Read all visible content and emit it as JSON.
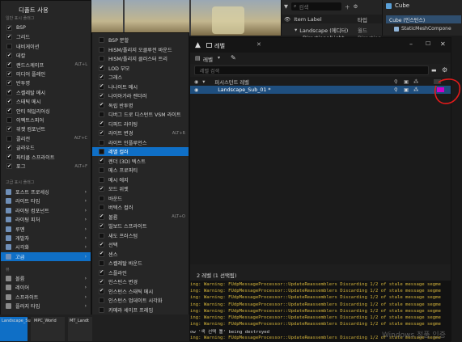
{
  "viewport": {},
  "outliner": {
    "search_placeholder": "검색",
    "col_item_label": "Item Label",
    "col_type": "타입",
    "row1_name": "Landscape (에디터)",
    "row1_type": "월드",
    "row2_name": "DirectionalLight",
    "row2_type": "Directiona"
  },
  "details": {
    "title": "Cube",
    "component_root": "Cube (인스턴스)",
    "component_child": "StaticMeshCompone"
  },
  "main_menu": {
    "title": "디폴트 사용",
    "section_general": "일반 표시 플래그",
    "items": [
      {
        "label": "BSP",
        "checked": true
      },
      {
        "label": "그리드",
        "checked": true
      },
      {
        "label": "내비게이션",
        "checked": false
      },
      {
        "label": "데칼",
        "checked": true
      },
      {
        "label": "랜드스케이프",
        "checked": true,
        "shortcut": "ALT+L"
      },
      {
        "label": "미디어 플레인",
        "checked": true
      },
      {
        "label": "반투명",
        "checked": true
      },
      {
        "label": "스켈레탈 메시",
        "checked": true
      },
      {
        "label": "스태틱 메시",
        "checked": true
      },
      {
        "label": "안티 에일리어싱",
        "checked": true
      },
      {
        "label": "이펙트스피어",
        "checked": false
      },
      {
        "label": "위젯 컴포넌트",
        "checked": true
      },
      {
        "label": "콜리전",
        "checked": false,
        "shortcut": "ALT+C"
      },
      {
        "label": "글라우드",
        "checked": true
      },
      {
        "label": "파티클 스프라이트",
        "checked": true
      },
      {
        "label": "포그",
        "checked": true,
        "shortcut": "ALT+F"
      }
    ],
    "section_advanced": "고급 표시 플래그",
    "submenus": [
      {
        "label": "포스트 프로세싱"
      },
      {
        "label": "라이트 타입"
      },
      {
        "label": "라이팅 컴포넌트"
      },
      {
        "label": "라이팅 피처"
      },
      {
        "label": "루멘"
      },
      {
        "label": "개발자"
      },
      {
        "label": "시각화"
      },
      {
        "label": "고급"
      }
    ],
    "section_views": "뷰",
    "view_submenus": [
      {
        "label": "볼륨"
      },
      {
        "label": "레이어"
      },
      {
        "label": "스프라이트"
      },
      {
        "label": "플러지 타입"
      }
    ]
  },
  "sub_menu": {
    "items": [
      {
        "label": "BSP 분할",
        "checked": false
      },
      {
        "label": "HISM/폴리지 오클루전 바운드",
        "checked": false
      },
      {
        "label": "HISM/폴리지 클러스터 트리",
        "checked": false
      },
      {
        "label": "LOD 부모",
        "checked": true
      },
      {
        "label": "그래스",
        "checked": true
      },
      {
        "label": "나나이트 메시",
        "checked": true
      },
      {
        "label": "나이아가라 렌더러",
        "checked": true
      },
      {
        "label": "독립 반투명",
        "checked": true
      },
      {
        "label": "디버그 드로 디스턴트 VSM 라이트",
        "checked": false
      },
      {
        "label": "디퍼드 라이팅",
        "checked": true
      },
      {
        "label": "라이트 변경",
        "checked": true,
        "shortcut": "ALT+R"
      },
      {
        "label": "라이트 인플루언스",
        "checked": false
      },
      {
        "label": "레벨 컬러",
        "checked": false,
        "selected": true
      },
      {
        "label": "렌더 (3D) 텍스트",
        "checked": true
      },
      {
        "label": "메스 프로퍼티",
        "checked": false
      },
      {
        "label": "메시 에지",
        "checked": false
      },
      {
        "label": "모드 위젯",
        "checked": true
      },
      {
        "label": "바운드",
        "checked": false
      },
      {
        "label": "버텍스 컬러",
        "checked": false
      },
      {
        "label": "볼륨",
        "checked": true,
        "shortcut": "ALT+O"
      },
      {
        "label": "빌보드 스프라이트",
        "checked": true
      },
      {
        "label": "새도 프러스텀",
        "checked": false
      },
      {
        "label": "선택",
        "checked": true
      },
      {
        "label": "센스",
        "checked": true
      },
      {
        "label": "스켈레탈 바운드",
        "checked": false
      },
      {
        "label": "스플라인",
        "checked": true
      },
      {
        "label": "인스턴스 변경",
        "checked": true
      },
      {
        "label": "인스턴스 스태틱 메시",
        "checked": true
      },
      {
        "label": "인스턴스 업데이트 시각화",
        "checked": false
      },
      {
        "label": "카메라 세이프 프레임",
        "checked": false
      },
      {
        "label": "카메라 종횡비 떠대",
        "checked": false
      },
      {
        "label": "컬러 그레이딩",
        "checked": false
      }
    ]
  },
  "layer_panel": {
    "tab_title": "레벨",
    "toolbar_label": "레벨",
    "search_placeholder": "레벨 검색",
    "rows": [
      {
        "name": "퍼시스턴트 레벨",
        "selected": false
      },
      {
        "name": "Landscape_Sub_01",
        "selected": true
      }
    ],
    "count_text": "2 레벨 (1 선택됨)",
    "level_color_hex": "#cc00cc"
  },
  "log": {
    "lines": [
      "ing: Warning: FUdpMessageProcessor::UpdateReassemblers Discarding 1/2 of stale message segme",
      "ing: Warning: FUdpMessageProcessor::UpdateReassemblers Discarding 1/2 of stale message segme",
      "ing: Warning: FUdpMessageProcessor::UpdateReassemblers Discarding 1/2 of stale message segme",
      "ing: Warning: FUdpMessageProcessor::UpdateReassemblers Discarding 1/2 of stale message segme",
      "ing: Warning: FUdpMessageProcessor::UpdateReassemblers Discarding 1/2 of stale message segme",
      "ing: Warning: FUdpMessageProcessor::UpdateReassemblers Discarding 1/2 of stale message segme",
      "ing: Warning: FUdpMessageProcessor::UpdateReassemblers Discarding 1/2 of stale message segme",
      "ow '색 선택 툴' being destroyed",
      "ing: Warning: FUdpMessageProcessor::UpdateReassemblers Discarding 1/2 of stale message segme"
    ]
  },
  "content_browser": {
    "assets": [
      {
        "label": "Landscape_Sub_01",
        "selected": true
      },
      {
        "label": "MPC_World",
        "selected": false
      },
      {
        "label": "MT_Landt",
        "selected": false
      }
    ]
  },
  "watermark": "Windows 정품 인증",
  "colors": {
    "accent": "#0f6fc6",
    "log_warning": "#d4b43a",
    "annotation_red": "#e21b1b"
  }
}
